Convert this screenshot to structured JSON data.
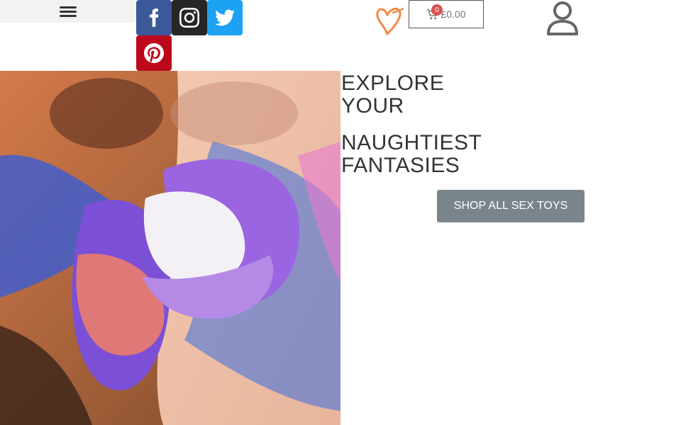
{
  "header": {
    "menu_icon": "hamburger-menu-icon",
    "social": [
      {
        "name": "facebook",
        "icon": "facebook-icon",
        "color": "#3b5998"
      },
      {
        "name": "instagram",
        "icon": "instagram-icon",
        "color": "#262626"
      },
      {
        "name": "twitter",
        "icon": "twitter-icon",
        "color": "#1da1f2"
      },
      {
        "name": "pinterest",
        "icon": "pinterest-icon",
        "color": "#bd081c"
      }
    ],
    "logo_icon": "heart-logo-icon",
    "cart": {
      "count": "0",
      "total": "£0.00",
      "icon": "cart-icon"
    },
    "account_icon": "user-icon"
  },
  "hero": {
    "title_line1": "EXPLORE",
    "title_line2": "YOUR",
    "title_line3": "NAUGHTIEST",
    "title_line4": "FANTASIES",
    "button_label": "SHOP ALL SEX TOYS",
    "button_color": "#7a858b",
    "image_icon": "hero-photo-lips"
  }
}
